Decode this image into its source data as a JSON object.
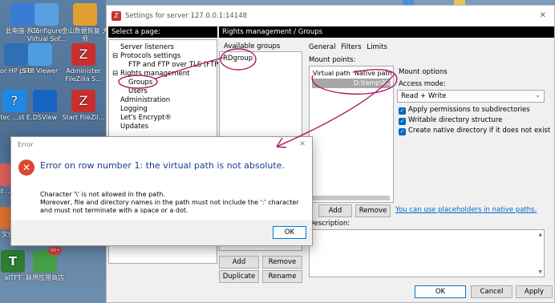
{
  "desktop": {
    "icons": [
      {
        "label": "此电脑·系统",
        "color": "#3a7bd5"
      },
      {
        "label": "Configure Virtual Sof...",
        "color": "#5aa0e0"
      },
      {
        "label": "金山数据恢复 大师",
        "color": "#e0a030"
      },
      {
        "label": "for HP plies",
        "color": "#2f6fb5"
      },
      {
        "label": "STP Viewer",
        "color": "#4f9de0"
      },
      {
        "label": "Administer FileZilla S...",
        "color": "#c9302c"
      },
      {
        "label": "antec ...st E...",
        "color": "#1e88e5"
      },
      {
        "label": "DSView",
        "color": "#1565c0"
      },
      {
        "label": "Start FileZil...",
        "color": "#c9302c"
      },
      {
        "label": "ant ...st E...",
        "color": "#e06060"
      },
      {
        "label": "文件转",
        "color": "#e07030"
      },
      {
        "label": "alTFT",
        "color": "#2e7d32"
      },
      {
        "label": "联想应用商店",
        "color": "#43a047"
      }
    ],
    "badge": "99+"
  },
  "window": {
    "title": "Settings for server 127.0.0.1:14148",
    "close_glyph": "✕"
  },
  "left_header": "Select a page:",
  "tree": [
    "Server listeners",
    "Protocols settings",
    "FTP and FTP over TLS (FTPS)",
    "Rights management",
    "Groups",
    "Users",
    "Administration",
    "Logging",
    "Let's Encrypt®",
    "Updates"
  ],
  "tree_toggles": [
    "⊟",
    "⊟"
  ],
  "right_header": "Rights management / Groups",
  "groups": {
    "title": "Available groups",
    "items": [
      "RDgroup"
    ],
    "add": "Add",
    "remove": "Remove",
    "duplicate": "Duplicate",
    "rename": "Rename"
  },
  "tabs": [
    "General",
    "Filters",
    "Limits"
  ],
  "mount": {
    "label": "Mount points:",
    "col_virtual": "Virtual path",
    "col_native": "Native path",
    "row_native": "D:\\temp\\RD",
    "add": "Add",
    "remove": "Remove",
    "link": "You can use placeholders in native paths."
  },
  "mount_options": {
    "title": "Mount options",
    "access_label": "Access mode:",
    "access_value": "Read + Write",
    "checks": [
      "Apply permissions to subdirectories",
      "Writable directory structure",
      "Create native directory if it does not exist"
    ]
  },
  "description_label": "Description:",
  "footer": {
    "ok": "OK",
    "cancel": "Cancel",
    "apply": "Apply"
  },
  "error_dialog": {
    "title": "Error",
    "heading": "Error on row number 1: the virtual path is not absolute.",
    "line1": "Character '\\' is not allowed in the path.",
    "line2": "Moreover, file and directory names in the path must not include the ':' character and must not terminate with a space or a dot.",
    "ok": "OK",
    "close_glyph": "✕"
  },
  "colors": {
    "accent": "#0067c0",
    "annotation": "#b0186a",
    "error": "#d9482f",
    "link": "#0066cc"
  }
}
